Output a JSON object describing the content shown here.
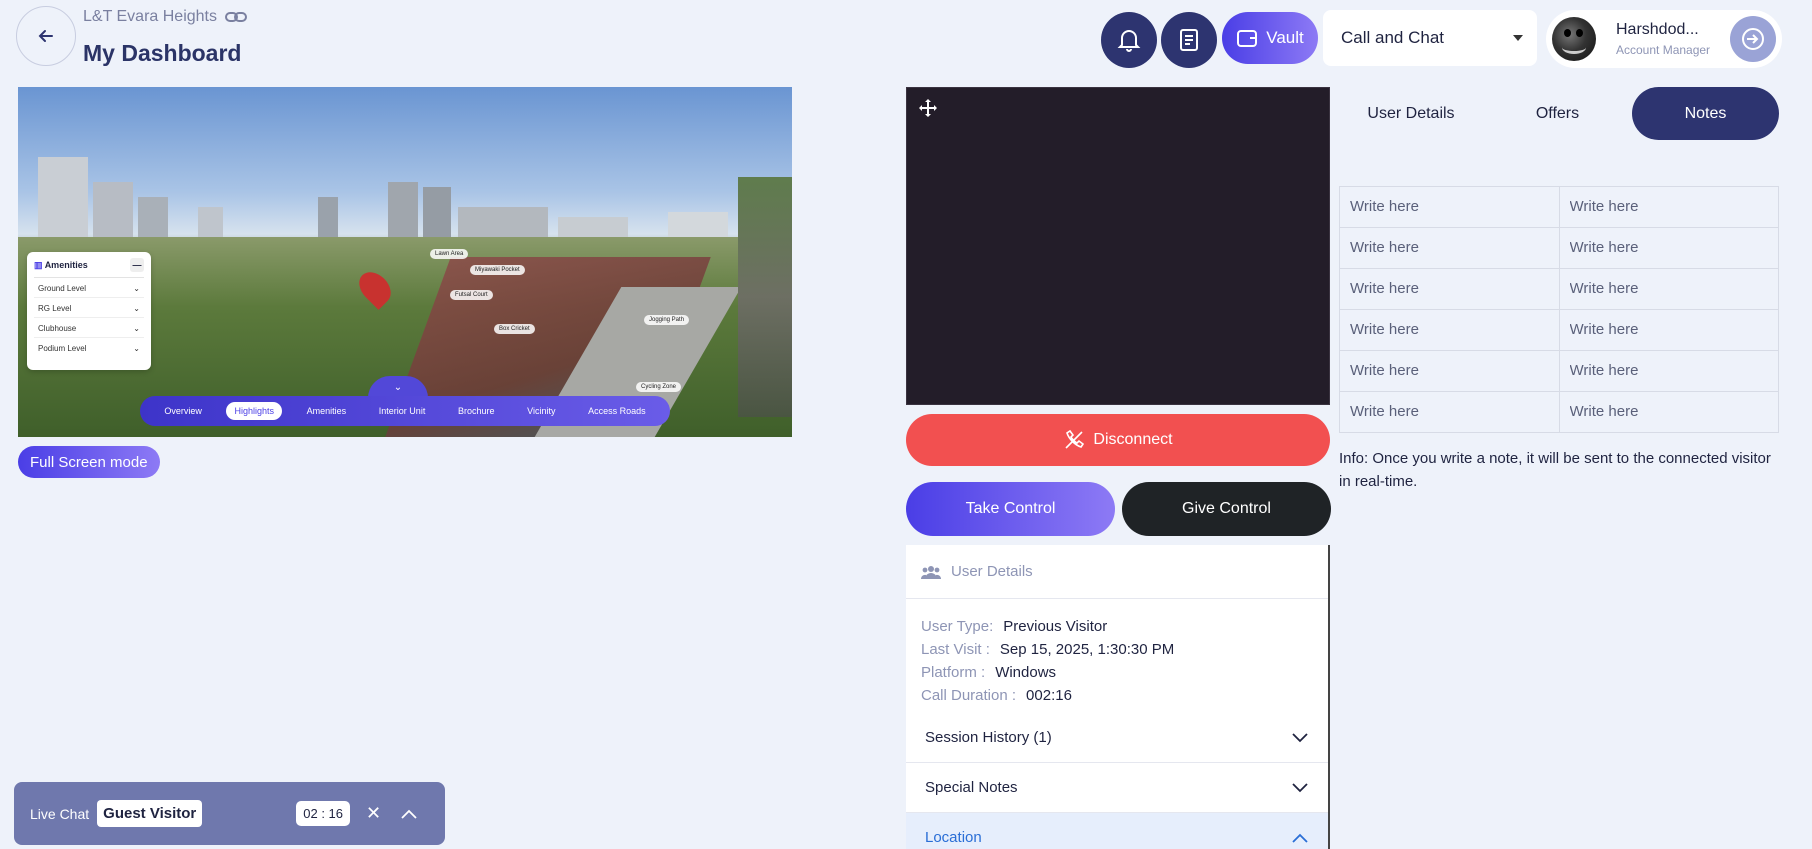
{
  "header": {
    "project_name": "L&T Evara Heights",
    "title": "My Dashboard",
    "vault_label": "Vault",
    "mode_select": "Call and Chat",
    "user_name": "Harshdod...",
    "user_role": "Account Manager"
  },
  "tour": {
    "panel_title": "Amenities",
    "levels": [
      "Ground Level",
      "RG Level",
      "Clubhouse",
      "Podium Level"
    ],
    "poi": [
      "Lawn Area",
      "Miyawaki Pocket",
      "Futsal Court",
      "Box Cricket",
      "Jogging Path",
      "Cycling Zone"
    ],
    "nav": [
      "Overview",
      "Highlights",
      "Amenities",
      "Interior Unit",
      "Brochure",
      "Vicinity",
      "Access Roads"
    ],
    "active_nav": "Highlights"
  },
  "fullscreen_label": "Full Screen mode",
  "call": {
    "disconnect_label": "Disconnect",
    "take_control_label": "Take Control",
    "give_control_label": "Give Control"
  },
  "user_details": {
    "header": "User Details",
    "rows": [
      {
        "label": "User Type:",
        "value": "Previous Visitor"
      },
      {
        "label": "Last Visit :",
        "value": "Sep 15, 2025, 1:30:30 PM"
      },
      {
        "label": "Platform :",
        "value": "Windows"
      },
      {
        "label": "Call Duration :",
        "value": "002:16"
      }
    ],
    "accordions": [
      {
        "label": "Session History (1)",
        "expanded": false
      },
      {
        "label": "Special Notes",
        "expanded": false
      },
      {
        "label": "Location",
        "expanded": true
      }
    ]
  },
  "tabs": [
    {
      "label": "User Details",
      "active": false
    },
    {
      "label": "Offers",
      "active": false
    },
    {
      "label": "Notes",
      "active": true
    }
  ],
  "notes": {
    "placeholder": "Write here",
    "info": "Info: Once you write a note, it will be sent to the connected visitor in real-time."
  },
  "live_chat": {
    "title": "Live Chat",
    "visitor": "Guest Visitor",
    "timer": "02 : 16"
  },
  "colors": {
    "primary": "#2d3470",
    "accent": "#4a3ee6",
    "danger": "#f25050",
    "background": "#eef2fa"
  }
}
